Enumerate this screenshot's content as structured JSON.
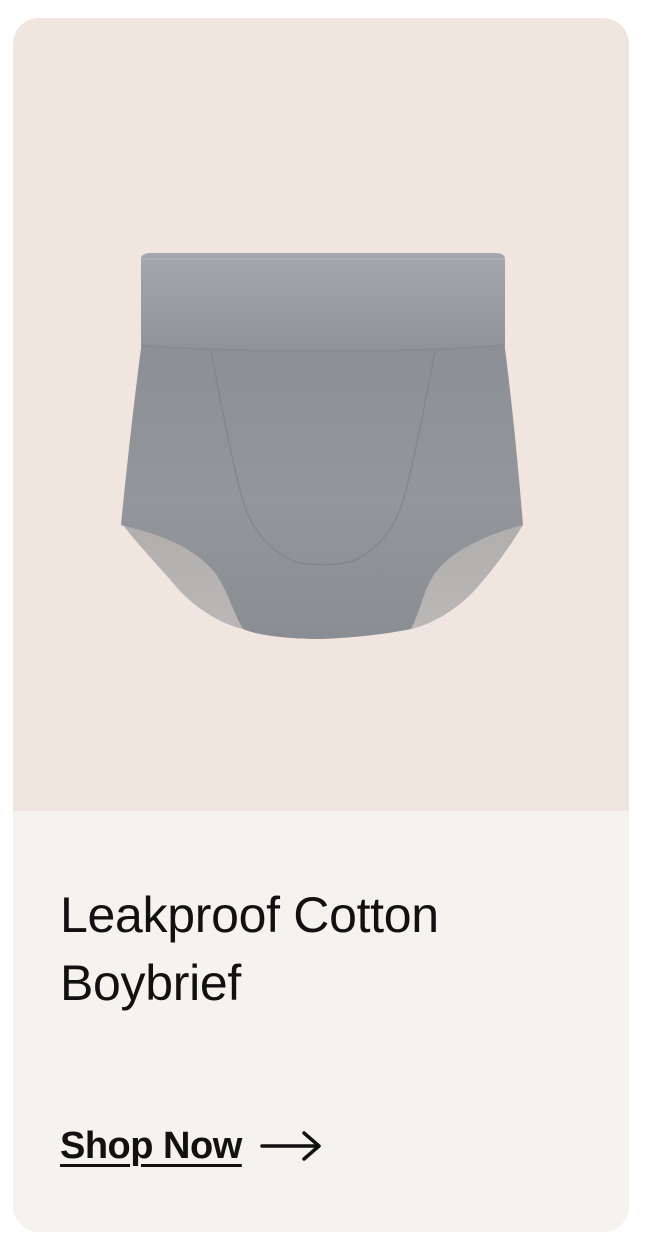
{
  "product": {
    "title": "Leakproof Cotton Boybrief",
    "image_icon": "gray-cotton-boybrief-image",
    "colors": {
      "image_background": "#f0e6df",
      "card_background": "#f6f2ee",
      "fabric": "#8f9297",
      "waistband": "#9a9da2",
      "text": "#111111"
    }
  },
  "cta": {
    "label": "Shop Now",
    "icon": "arrow-right-icon"
  }
}
